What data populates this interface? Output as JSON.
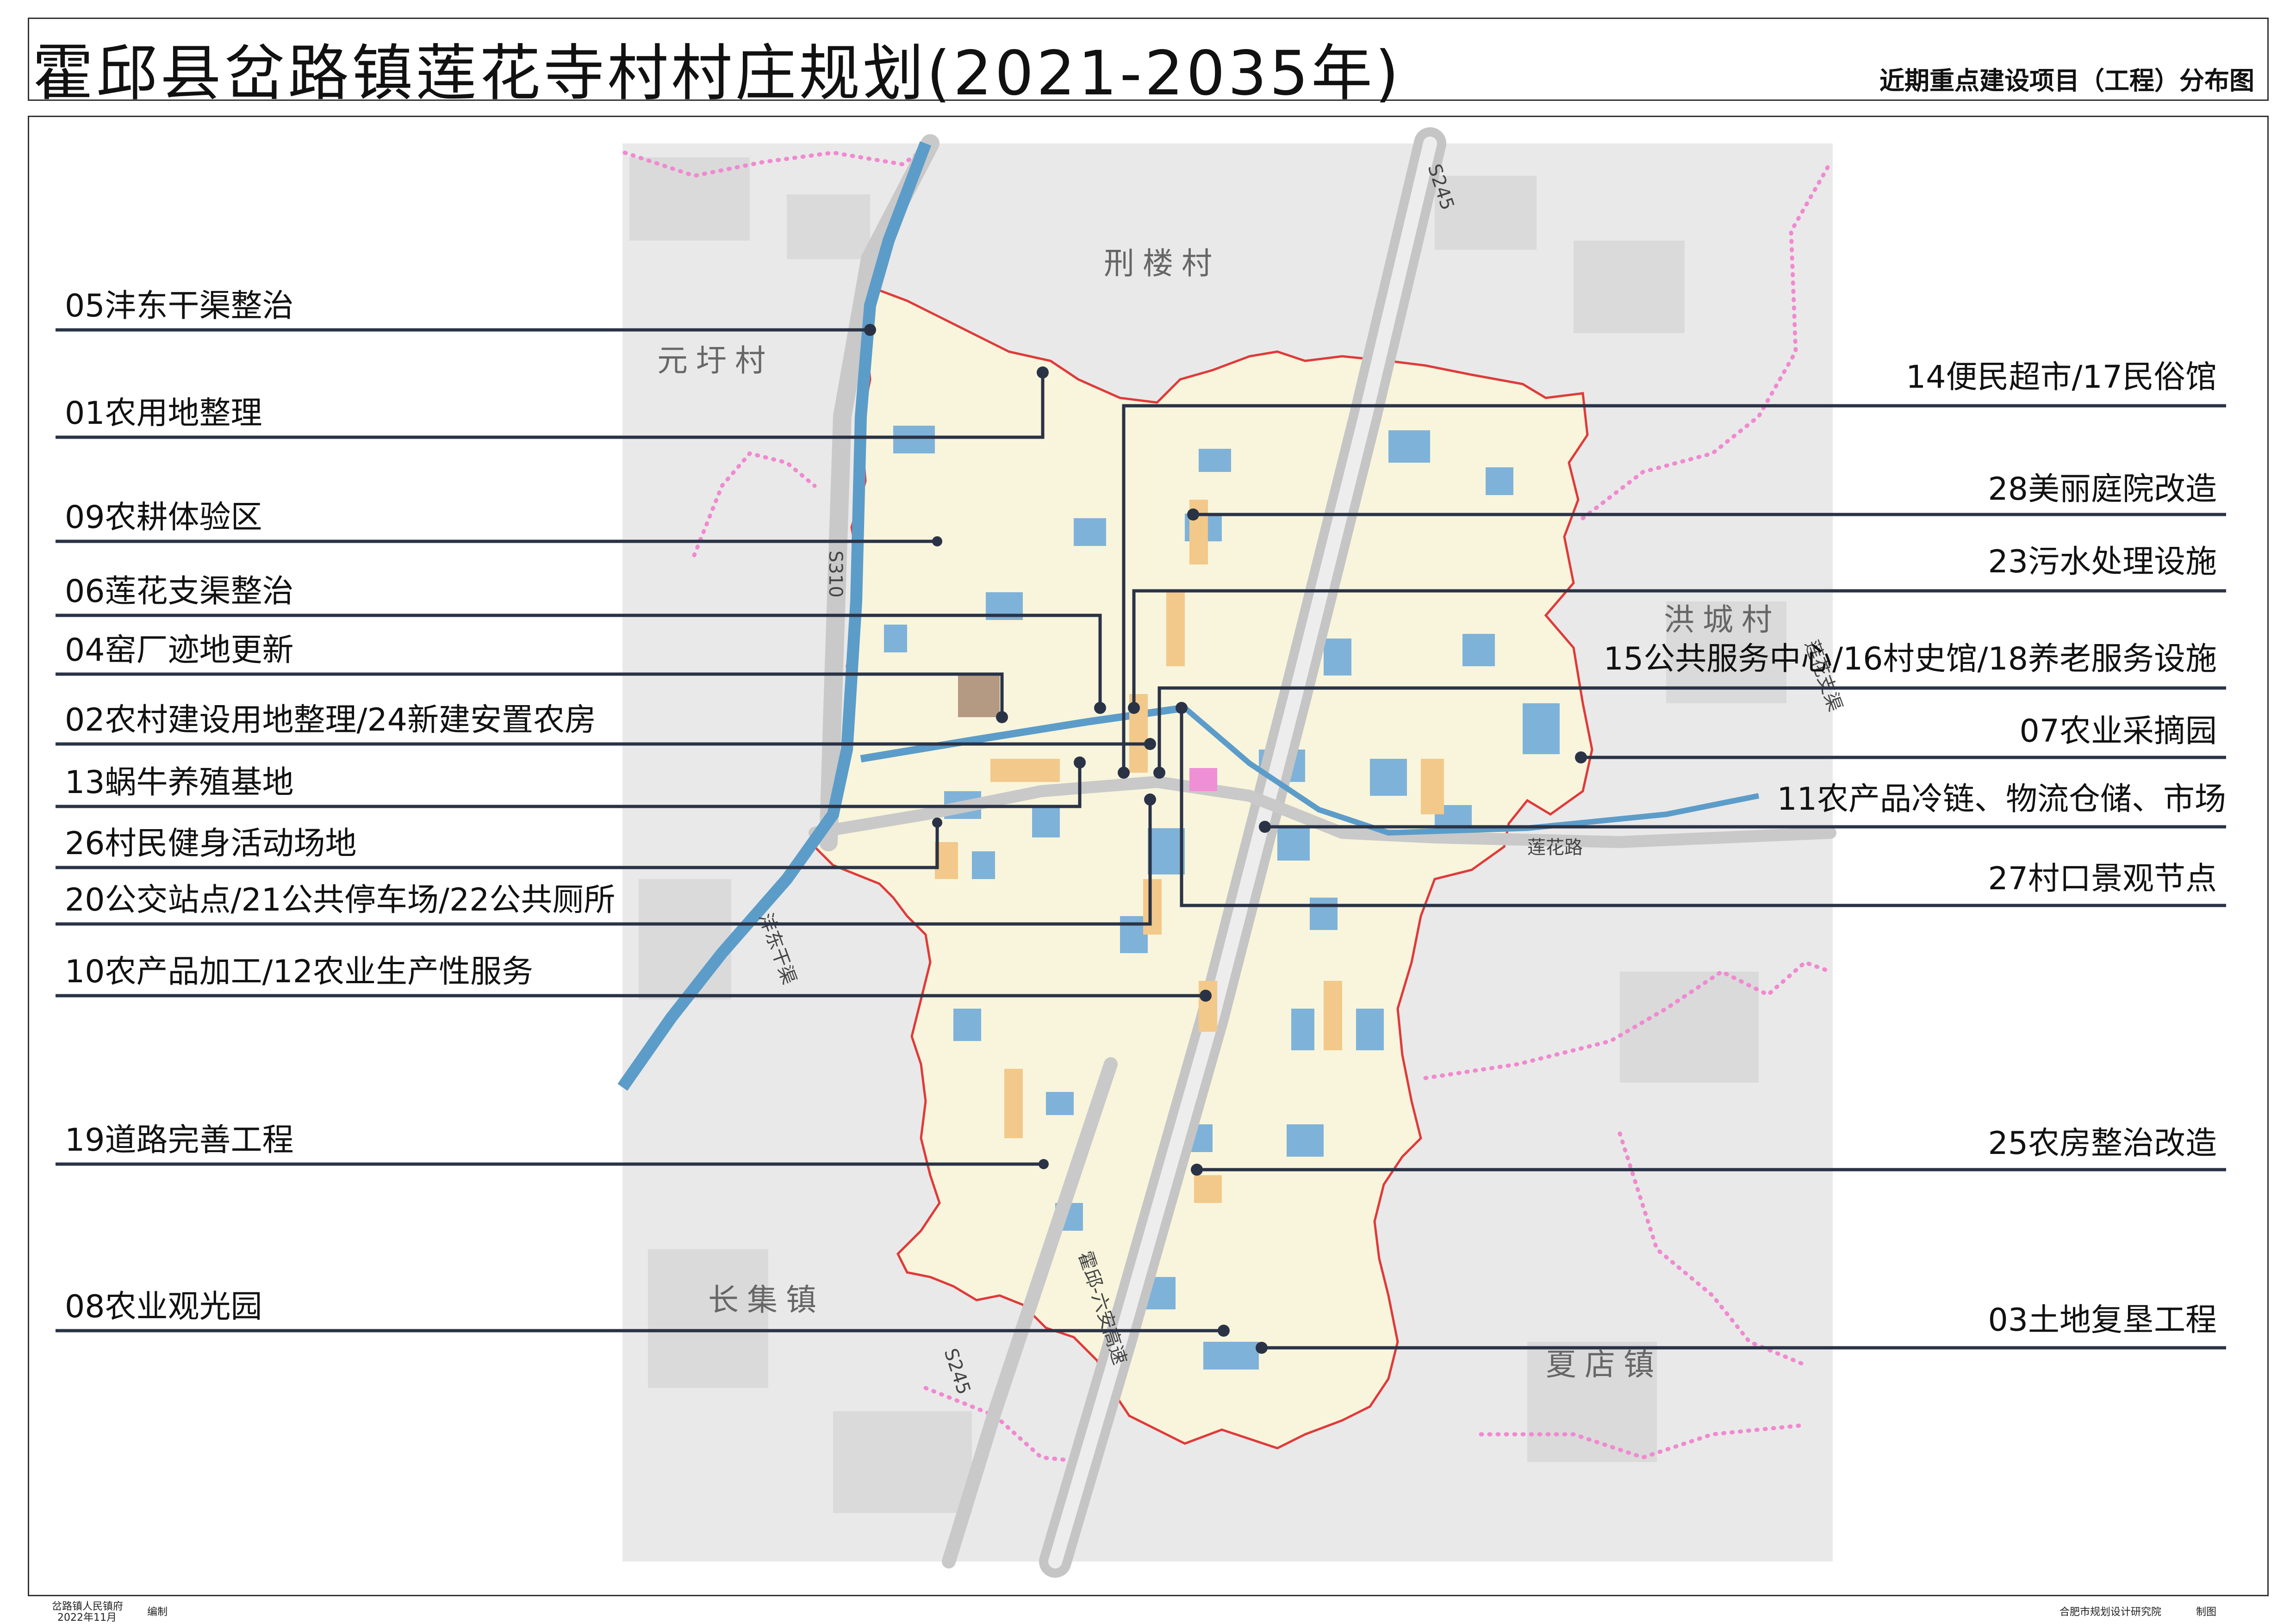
{
  "title": "霍邱县岔路镇莲花寺村村庄规划(2021-2035年)",
  "subtitle": "近期重点建设项目（工程）分布图",
  "places": {
    "xinglou": "刑楼村",
    "yuanyu": "元圩村",
    "hongcheng": "洪城村",
    "changji": "长集镇",
    "xiadian": "夏店镇"
  },
  "roads": {
    "s245_top": "S245",
    "s245_bottom": "S245",
    "s310": "S310",
    "expressway": "霍邱-六安高速",
    "lianhua_road": "莲花路",
    "canal_east": "沣东干渠",
    "canal_lianhua": "莲花支渠"
  },
  "callouts_left": [
    "05沣东干渠整治",
    "01农用地整理",
    "09农耕体验区",
    "06莲花支渠整治",
    "04窑厂迹地更新",
    "02农村建设用地整理/24新建安置农房",
    "13蜗牛养殖基地",
    "26村民健身活动场地",
    "20公交站点/21公共停车场/22公共厕所",
    "10农产品加工/12农业生产性服务",
    "19道路完善工程",
    "08农业观光园"
  ],
  "callouts_right": [
    "14便民超市/17民俗馆",
    "28美丽庭院改造",
    "23污水处理设施",
    "15公共服务中心/16村史馆/18养老服务设施",
    "07农业采摘园",
    "11农产品冷链、物流仓储、市场",
    "27村口景观节点",
    "25农房整治改造",
    "03土地复垦工程"
  ],
  "footer": {
    "left_org": "岔路镇人民镇府",
    "left_date": "2022年11月",
    "left_action": "编制",
    "right_org": "合肥市规划设计研究院",
    "right_action": "制图"
  },
  "colors": {
    "village_fill": "#f8f5dc",
    "boundary": "#e03a3a",
    "township_boundary": "#f08ad0",
    "water": "#7fb2d8",
    "canal": "#5c9cc9",
    "road": "#c9c9c9",
    "leader": "#2a3346"
  }
}
